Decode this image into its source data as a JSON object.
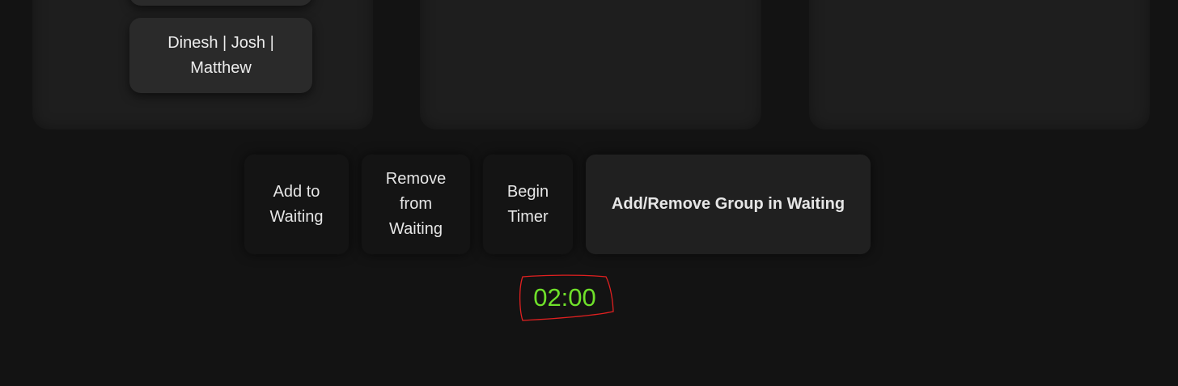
{
  "groups": {
    "current_group_label": "Dinesh | Josh | Matthew"
  },
  "actions": {
    "add_to_waiting": "Add to Waiting",
    "remove_from_waiting": "Remove from Waiting",
    "begin_timer": "Begin Timer",
    "add_remove_group": "Add/Remove Group in Waiting"
  },
  "timer": {
    "display": "02:00",
    "color": "#6fe02a",
    "annotation_color": "#e02020"
  },
  "theme": {
    "background": "#131313",
    "panel": "#1e1e1e",
    "card": "#2a2a2a"
  }
}
